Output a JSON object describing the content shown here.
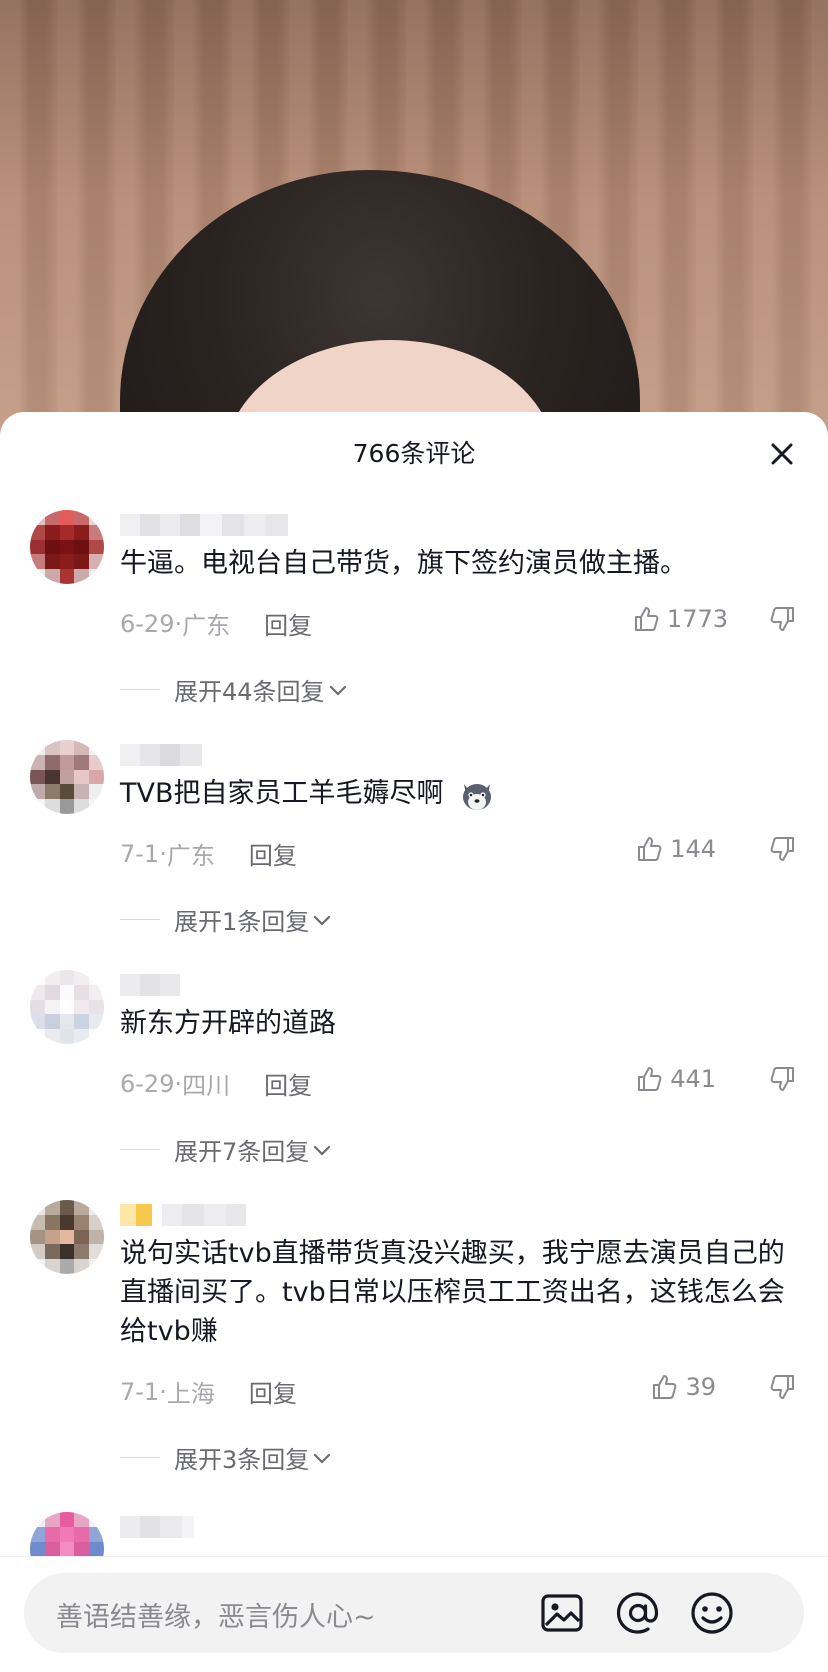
{
  "sheet": {
    "title": "766条评论"
  },
  "comments": [
    {
      "text": "牛逼。电视台自己带货，旗下签约演员做主播。",
      "date": "6-29",
      "location": "广东",
      "reply_label": "回复",
      "likes": "1773",
      "expand_label": "展开44条回复"
    },
    {
      "text": "TVB把自家员工羊毛薅尽啊",
      "date": "7-1",
      "location": "广东",
      "reply_label": "回复",
      "likes": "144",
      "expand_label": "展开1条回复"
    },
    {
      "text": "新东方开辟的道路",
      "date": "6-29",
      "location": "四川",
      "reply_label": "回复",
      "likes": "441",
      "expand_label": "展开7条回复"
    },
    {
      "text": "说句实话tvb直播带货真没兴趣买，我宁愿去演员自己的直播间买了。tvb日常以压榨员工工资出名，这钱怎么会给tvb赚",
      "date": "7-1",
      "location": "上海",
      "reply_label": "回复",
      "likes": "39",
      "expand_label": "展开3条回复"
    }
  ],
  "input": {
    "placeholder": "善语结善缘，恶言伤人心~"
  },
  "icons": [
    "close-icon",
    "like-icon",
    "dislike-icon",
    "chevron-down-icon",
    "image-icon",
    "at-icon",
    "emoji-icon"
  ],
  "colors": {
    "text_primary": "#161823",
    "text_secondary": "#a8a9ad",
    "accent_gray": "#6a6b70",
    "input_bg": "#f2f2f3"
  }
}
